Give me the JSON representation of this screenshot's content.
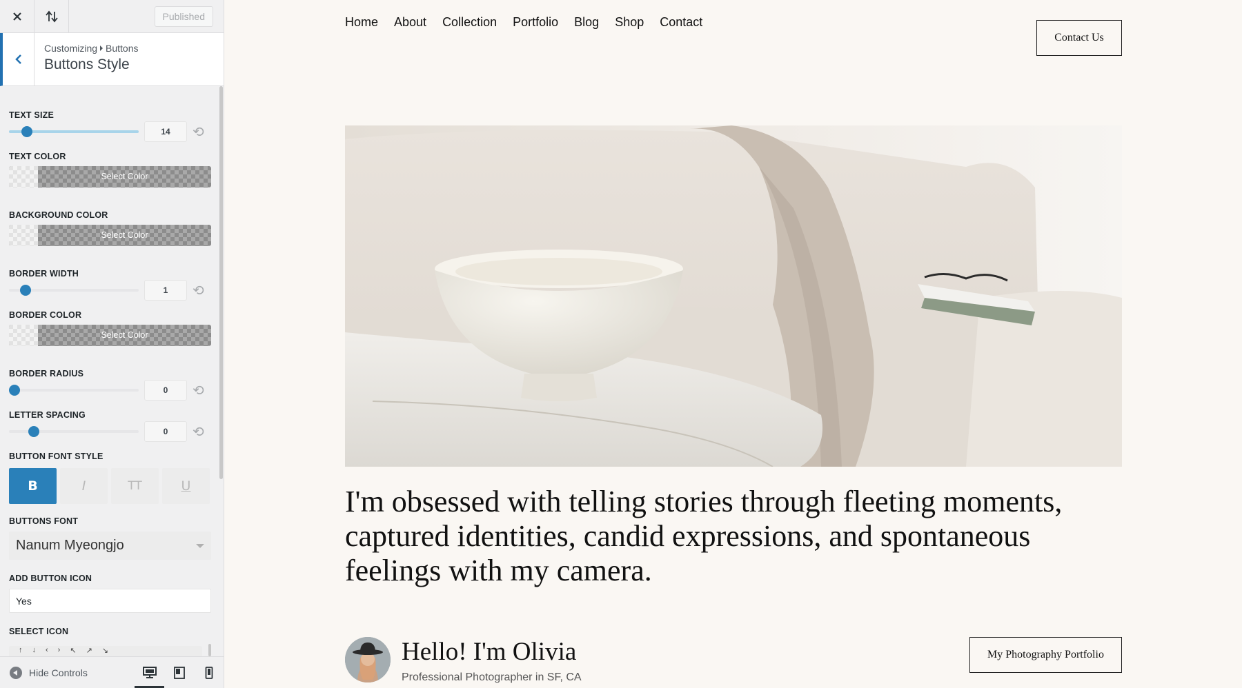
{
  "topbar": {
    "close_icon": "close-icon",
    "reorder_icon": "reorder-icon",
    "publish_label": "Published"
  },
  "section": {
    "breadcrumb_root": "Customizing",
    "breadcrumb_parent": "Buttons",
    "title": "Buttons Style"
  },
  "controls": {
    "text_size": {
      "label": "TEXT SIZE",
      "value": "14"
    },
    "text_color": {
      "label": "TEXT COLOR",
      "button": "Select Color"
    },
    "background_color": {
      "label": "BACKGROUND COLOR",
      "button": "Select Color"
    },
    "border_width": {
      "label": "BORDER WIDTH",
      "value": "1"
    },
    "border_color": {
      "label": "BORDER COLOR",
      "button": "Select Color"
    },
    "border_radius": {
      "label": "BORDER RADIUS",
      "value": "0"
    },
    "letter_spacing": {
      "label": "LETTER SPACING",
      "value": "0"
    },
    "font_style": {
      "label": "BUTTON FONT STYLE",
      "options": [
        "B",
        "I",
        "TT",
        "U"
      ],
      "selected": "B"
    },
    "buttons_font": {
      "label": "BUTTONS FONT",
      "value": "Nanum Myeongjo"
    },
    "add_button_icon": {
      "label": "ADD BUTTON ICON",
      "value": "Yes"
    },
    "select_icon": {
      "label": "SELECT ICON",
      "glyphs": [
        "↑",
        "↓",
        "‹",
        "›",
        "↖",
        "↗",
        "↘"
      ]
    }
  },
  "footer": {
    "hide_label": "Hide Controls",
    "devices": [
      "desktop",
      "tablet",
      "mobile"
    ],
    "active_device": "desktop"
  },
  "site": {
    "nav": [
      "Home",
      "About",
      "Collection",
      "Portfolio",
      "Blog",
      "Shop",
      "Contact"
    ],
    "contact_button": "Contact Us",
    "headline": "I'm obsessed with telling stories through fleeting moments, captured identities, candid expressions, and spontaneous feelings with my camera.",
    "greeting": "Hello! I'm Olivia",
    "subtitle": "Professional Photographer in SF, CA",
    "portfolio_button": "My Photography Portfolio"
  },
  "colors": {
    "accent": "#2a80b9",
    "wp_blue": "#2271b1",
    "preview_bg": "#faf7f3"
  }
}
